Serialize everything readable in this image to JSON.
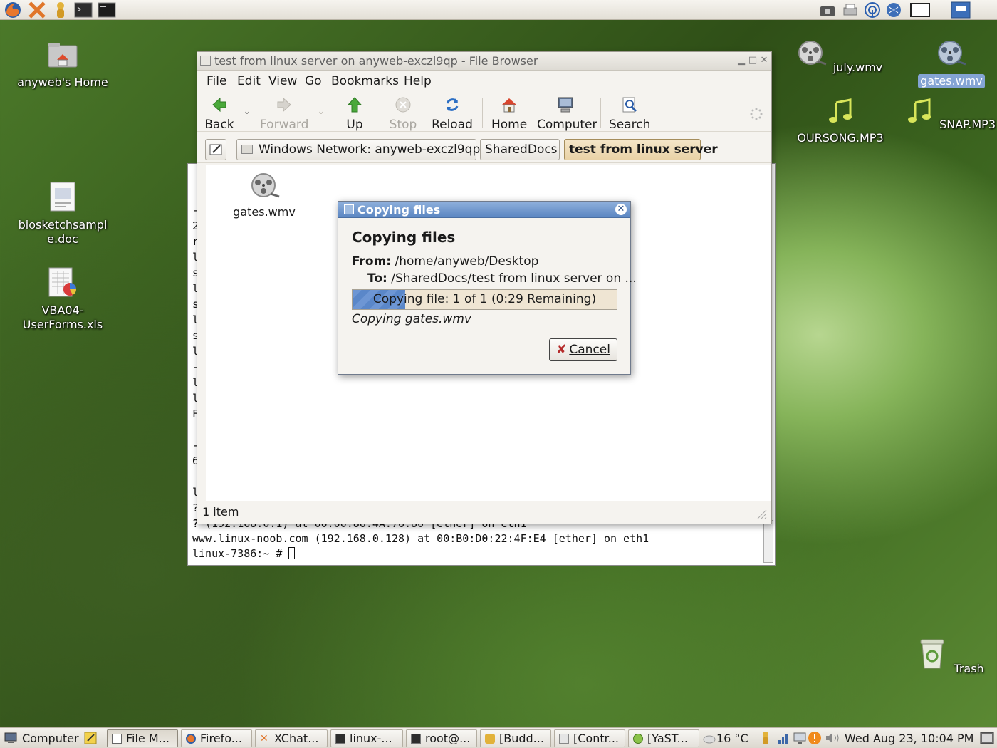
{
  "top_panel": {
    "launchers": [
      "firefox-icon",
      "xchat-icon",
      "buddy-icon",
      "terminal-icon",
      "console-icon"
    ],
    "tray": [
      "camera-icon",
      "printer-icon",
      "wireless-icon",
      "network-icon",
      "display-icon",
      "window-icon"
    ]
  },
  "desktop": {
    "icons": [
      {
        "label": "anyweb's Home",
        "icon": "home-folder-icon"
      },
      {
        "label": "biosketchsample.doc",
        "label_line1": "biosketchsampl",
        "label_line2": "e.doc",
        "icon": "document-icon"
      },
      {
        "label": "VBA04-UserForms.xls",
        "label_line1": "VBA04-",
        "label_line2": "UserForms.xls",
        "icon": "spreadsheet-icon"
      },
      {
        "label": "july.wmv",
        "icon": "video-file-icon"
      },
      {
        "label": "gates.wmv",
        "icon": "video-file-icon",
        "selected": true
      },
      {
        "label": "OURSONG.MP3",
        "icon": "music-file-icon"
      },
      {
        "label": "SNAP.MP3",
        "icon": "music-file-icon"
      },
      {
        "label": "Trash",
        "icon": "trash-icon"
      }
    ]
  },
  "terminal": {
    "lines": [
      "? (192.168.0.1) at 00:00:86:4A:76:80 [ether] on eth1",
      "www.linux-noob.com (192.168.0.128) at 00:B0:D0:22:4F:E4 [ether] on eth1",
      "linux-7386:~ # "
    ],
    "left_margin_chars": [
      "-",
      "2",
      "r",
      "l",
      "s",
      "l",
      "s",
      "l",
      "s",
      "l",
      "-",
      "l",
      "l",
      "F",
      "",
      "-",
      "6",
      "",
      "l",
      "?",
      "?"
    ]
  },
  "file_browser": {
    "title": "test from linux server on anyweb-exczl9qp - File Browser",
    "menu": [
      "File",
      "Edit",
      "View",
      "Go",
      "Bookmarks",
      "Help"
    ],
    "toolbar": {
      "back": "Back",
      "forward": "Forward",
      "up": "Up",
      "stop": "Stop",
      "reload": "Reload",
      "home": "Home",
      "computer": "Computer",
      "search": "Search"
    },
    "breadcrumbs": [
      "Windows Network: anyweb-exczl9qp",
      "SharedDocs",
      "test from linux server"
    ],
    "files": [
      {
        "name": "gates.wmv"
      }
    ],
    "status": "1 item"
  },
  "copy_dialog": {
    "window_title": "Copying files",
    "heading": "Copying files",
    "from_label": "From:",
    "from_value": "/home/anyweb/Desktop",
    "to_label": "To:",
    "to_value": "/SharedDocs/test from linux server on ...",
    "progress_text": "Copying file: 1 of 1 (0:29 Remaining)",
    "progress_fraction": 0.2,
    "current_file": "Copying gates.wmv",
    "cancel_label": "Cancel"
  },
  "taskbar": {
    "computer_label": "Computer",
    "tasks": [
      {
        "label": "File M...",
        "active": true
      },
      {
        "label": "Firefo..."
      },
      {
        "label": "XChat..."
      },
      {
        "label": "linux-..."
      },
      {
        "label": "root@..."
      },
      {
        "label": "[Budd..."
      },
      {
        "label": "[Contr..."
      },
      {
        "label": "[YaST..."
      }
    ],
    "weather": "16 °C",
    "clock": "Wed Aug 23, 10:04 PM"
  },
  "colors": {
    "dialog_title": "#5b86c2",
    "progress": "#6d96d4",
    "selected_label": "#84a4d4"
  }
}
